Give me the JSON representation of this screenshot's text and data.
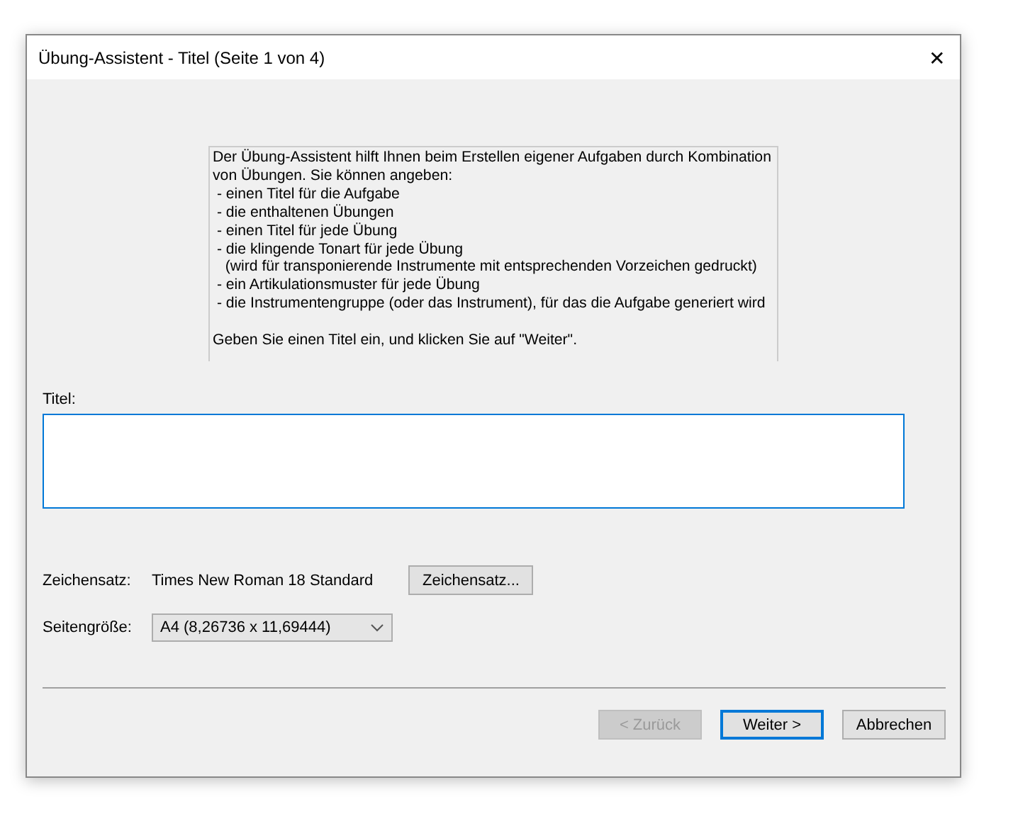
{
  "window": {
    "title": "Übung-Assistent - Titel (Seite 1 von 4)",
    "close": "✕"
  },
  "info": {
    "lines": [
      "Der Übung-Assistent hilft Ihnen beim Erstellen eigener Aufgaben durch Kombination",
      "von Übungen. Sie können angeben:",
      " - einen Titel für die Aufgabe",
      " - die enthaltenen Übungen",
      " - einen Titel für jede Übung",
      " - die klingende Tonart für jede Übung",
      "   (wird für transponierende Instrumente mit entsprechenden Vorzeichen gedruckt)",
      " - ein Artikulationsmuster für jede Übung",
      " - die Instrumentengruppe (oder das Instrument), für das die Aufgabe generiert wird"
    ],
    "footer": "Geben Sie einen Titel ein, und klicken Sie auf \"Weiter\"."
  },
  "title_field": {
    "label": "Titel:"
  },
  "font": {
    "label": "Zeichensatz:",
    "value": "Times New Roman 18 Standard",
    "button": "Zeichensatz..."
  },
  "page_size": {
    "label": "Seitengröße:",
    "value": "A4 (8,26736 x 11,69444)"
  },
  "buttons": [
    {
      "label": "< Zurück",
      "disabled": true,
      "default": false
    },
    {
      "label": "Weiter >",
      "disabled": false,
      "default": true
    },
    {
      "label": "Abbrechen",
      "disabled": false,
      "default": false
    }
  ]
}
